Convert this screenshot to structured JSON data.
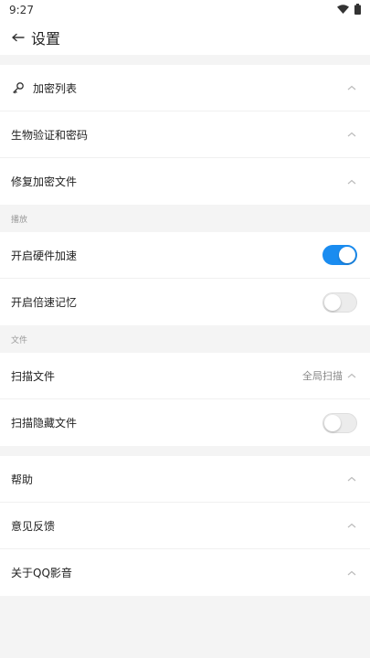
{
  "status_bar": {
    "time": "9:27"
  },
  "header": {
    "title": "设置"
  },
  "colors": {
    "accent": "#1a8cf0",
    "background": "#f4f4f4"
  },
  "group1": [
    {
      "label": "加密列表",
      "icon": "key-icon"
    },
    {
      "label": "生物验证和密码"
    },
    {
      "label": "修复加密文件"
    }
  ],
  "playback": {
    "header": "播放",
    "hw_accel": {
      "label": "开启硬件加速",
      "enabled": true
    },
    "speed_memory": {
      "label": "开启倍速记忆",
      "enabled": false
    }
  },
  "files": {
    "header": "文件",
    "scan": {
      "label": "扫描文件",
      "value": "全局扫描"
    },
    "scan_hidden": {
      "label": "扫描隐藏文件",
      "enabled": false
    }
  },
  "group_other": [
    {
      "label": "帮助"
    },
    {
      "label": "意见反馈"
    },
    {
      "label": "关于QQ影音"
    }
  ]
}
